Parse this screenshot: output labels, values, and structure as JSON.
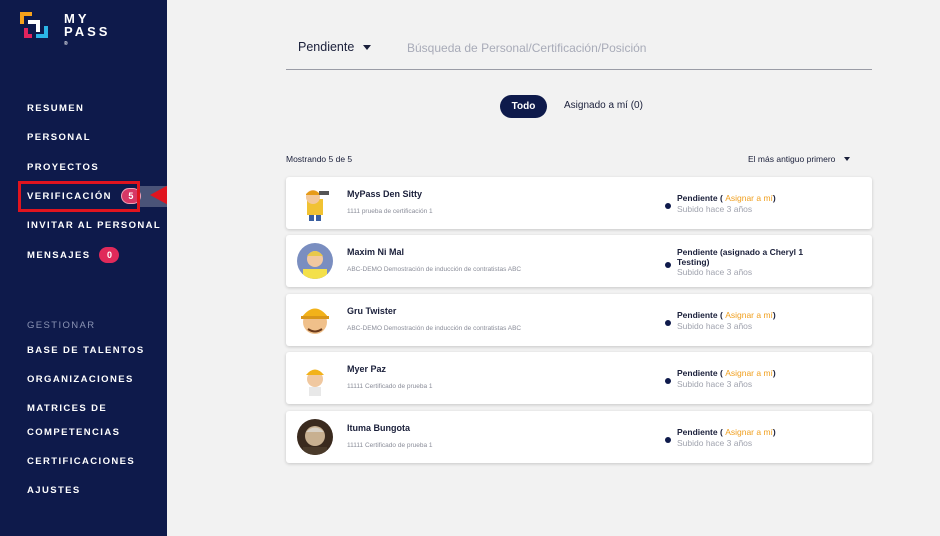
{
  "logo": {
    "line1": "MY",
    "line2": "PASS",
    "tm": "®"
  },
  "sidebar": {
    "items": [
      {
        "label": "RESUMEN"
      },
      {
        "label": "PERSONAL"
      },
      {
        "label": "PROYECTOS"
      },
      {
        "label": "VERIFICACIÓN",
        "badge": "5"
      },
      {
        "label": "INVITAR AL PERSONAL"
      },
      {
        "label": "MENSAJES",
        "badge": "0"
      }
    ],
    "section_label": "GESTIONAR",
    "manage_items": [
      {
        "label": "BASE DE TALENTOS"
      },
      {
        "label": "ORGANIZACIONES"
      },
      {
        "label": "MATRICES DE"
      },
      {
        "label": "COMPETENCIAS"
      },
      {
        "label": "CERTIFICACIONES"
      },
      {
        "label": "AJUSTES"
      }
    ]
  },
  "filter": {
    "status_value": "Pendiente",
    "search_placeholder": "Búsqueda de Personal/Certificación/Posición"
  },
  "tabs": {
    "all": "Todo",
    "mine": "Asignado a mí (0)"
  },
  "list": {
    "count_text": "Mostrando 5 de 5",
    "sort_value": "El más antiguo primero",
    "rows": [
      {
        "name": "MyPass Den Sitty",
        "sub": "1111 prueba de certificación 1",
        "status": "Pendiente",
        "assign": "Asignar a mí",
        "uploaded": "Subido hace 3 años"
      },
      {
        "name": "Maxim Ni Mal",
        "sub": "ABC-DEMO Demostración de inducción de contratistas ABC",
        "status": "Pendiente (asignado a Cheryl 1 Testing)",
        "assign": "",
        "uploaded": "Subido hace 3 años"
      },
      {
        "name": "Gru Twister",
        "sub": "ABC-DEMO Demostración de inducción de contratistas ABC",
        "status": "Pendiente",
        "assign": "Asignar a mí",
        "uploaded": "Subido hace 3 años"
      },
      {
        "name": "Myer Paz",
        "sub": "11111 Certificado de prueba 1",
        "status": "Pendiente",
        "assign": "Asignar a mí",
        "uploaded": "Subido hace 3 años"
      },
      {
        "name": "Ituma Bungota",
        "sub": "11111 Certificado de prueba 1",
        "status": "Pendiente",
        "assign": "Asignar a mí",
        "uploaded": "Subido hace 3 años"
      }
    ]
  },
  "colors": {
    "sidebar": "#0e1a4b",
    "badge": "#e02a5a",
    "accent": "#f0a020",
    "highlight": "#e0141e"
  }
}
